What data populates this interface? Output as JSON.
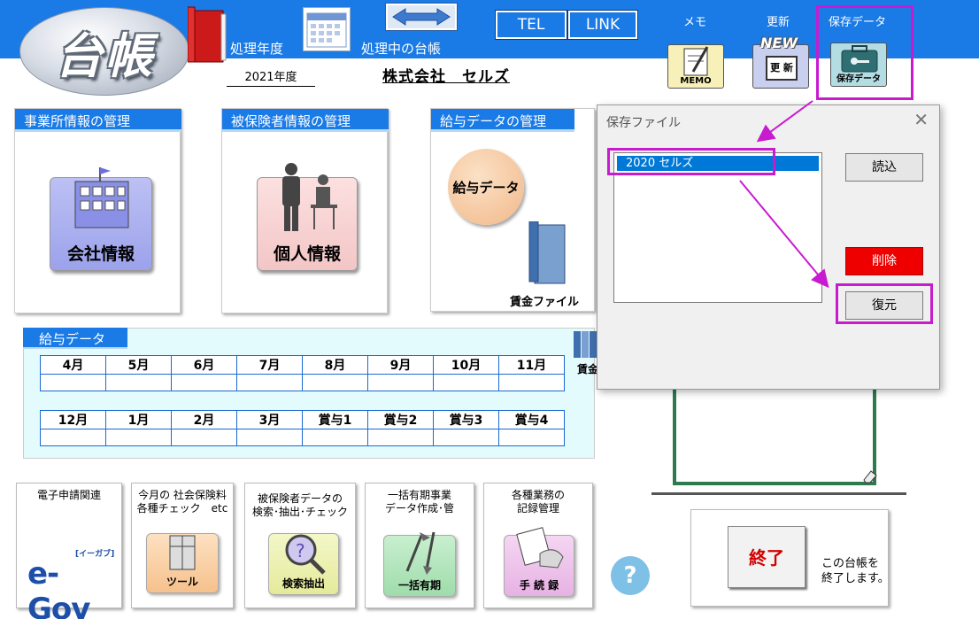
{
  "header": {
    "logo_text": "台帳",
    "fiscal_year_label": "処理年度",
    "current_ledger_label": "処理中の台帳",
    "fiscal_year_value": "2021年度",
    "company_name": "株式会社　セルズ",
    "tel_label": "TEL",
    "link_label": "LINK",
    "memo_label": "メモ",
    "memo_icon_text": "MEMO",
    "update_label": "更新",
    "update_icon_new": "NEW",
    "update_icon_text": "更 新",
    "save_label": "保存データ",
    "save_icon_text": "保存データ"
  },
  "panels": {
    "office": {
      "title": "事業所情報の管理",
      "button": "会社情報"
    },
    "insured": {
      "title": "被保険者情報の管理",
      "button": "個人情報"
    },
    "salary": {
      "title": "給与データの管理",
      "button": "給与データ",
      "wage_file": "賃金ファイル"
    }
  },
  "salary_data": {
    "tab": "給与データ",
    "row1": [
      "4月",
      "5月",
      "6月",
      "7月",
      "8月",
      "9月",
      "10月",
      "11月"
    ],
    "row2": [
      "12月",
      "1月",
      "2月",
      "3月",
      "賞与1",
      "賞与2",
      "賞与3",
      "賞与4"
    ],
    "side_label": "賃金"
  },
  "bottom_tools": [
    {
      "caption": "電子申請関連",
      "tile": "e-Gov",
      "tile_small": "[イーガブ]"
    },
    {
      "caption": "今月の 社会保険料\n各種チェック　etc",
      "tile": "ツール"
    },
    {
      "caption": "被保険者データの\n検索･抽出･チェック",
      "tile": "検索抽出"
    },
    {
      "caption": "一括有期事業\nデータ作成･管",
      "tile": "一括有期"
    },
    {
      "caption": "各種業務の\n記録管理",
      "tile": "手 続 録"
    }
  ],
  "help_label": "?",
  "exit": {
    "button": "終了",
    "note_line1": "この台帳を",
    "note_line2": "終了します。"
  },
  "dialog": {
    "title": "保存ファイル",
    "close": "✕",
    "list_items": [
      "2020 セルズ"
    ],
    "load_button": "読込",
    "delete_button": "削除",
    "restore_button": "復元"
  },
  "colors": {
    "header_blue": "#1a7ae6",
    "highlight_magenta": "#c81bd0",
    "delete_red": "#ee0000",
    "selection_blue": "#0078d7"
  }
}
